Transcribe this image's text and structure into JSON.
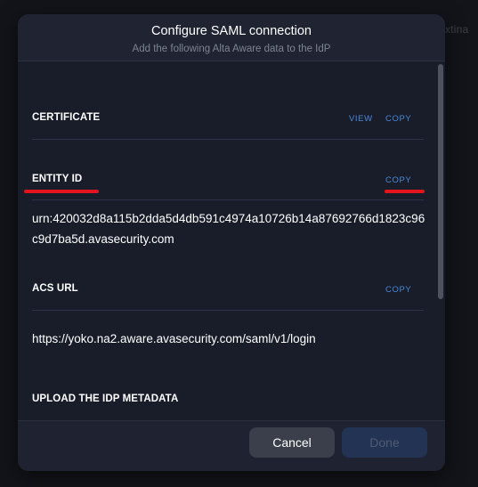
{
  "backdrop": {
    "partial_text": "xtina"
  },
  "modal": {
    "title": "Configure SAML connection",
    "subtitle": "Add the following Alta Aware data to the IdP"
  },
  "sections": {
    "certificate": {
      "label": "CERTIFICATE",
      "view_label": "VIEW",
      "copy_label": "COPY"
    },
    "entity_id": {
      "label": "ENTITY ID",
      "copy_label": "COPY",
      "value": "urn:420032d8a115b2dda5d4db591c4974a10726b14a87692766d1823c96c9d7ba5d.avasecurity.com"
    },
    "acs_url": {
      "label": "ACS URL",
      "copy_label": "COPY",
      "value": "https://yoko.na2.aware.avasecurity.com/saml/v1/login"
    },
    "upload": {
      "label": "UPLOAD THE IDP METADATA"
    }
  },
  "footer": {
    "cancel_label": "Cancel",
    "done_label": "Done"
  },
  "annotation": {
    "color": "#e2141d"
  }
}
